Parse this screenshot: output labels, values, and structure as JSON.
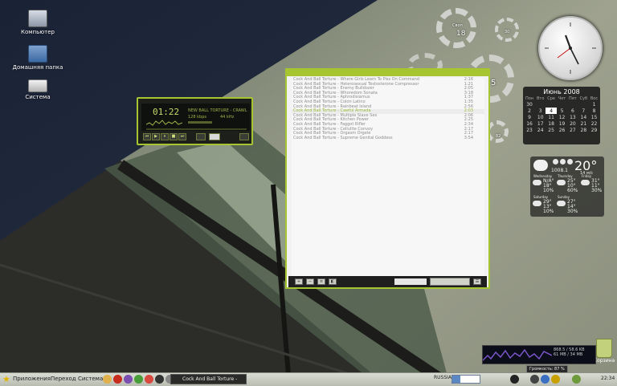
{
  "desktop": {
    "icons": [
      {
        "label": "Компьютер"
      },
      {
        "label": "Домашняя папка"
      },
      {
        "label": "Система"
      }
    ],
    "trash_label": "Корзина"
  },
  "widgets": {
    "ring_labels": {
      "disk_label": "Своп",
      "disk_value": "18",
      "cpu_value": "30",
      "mem_value": "5",
      "net_value": "82"
    },
    "calendar": {
      "month": "Июнь 2008",
      "weekdays": [
        "Пон",
        "Вто",
        "Сре",
        "Чет",
        "Пят",
        "Суб",
        "Вос"
      ],
      "weeks": [
        [
          "30",
          "",
          "",
          "",
          "",
          "",
          "1"
        ],
        [
          "2",
          "3",
          "4",
          "5",
          "6",
          "7",
          "8"
        ],
        [
          "9",
          "10",
          "11",
          "12",
          "13",
          "14",
          "15"
        ],
        [
          "16",
          "17",
          "18",
          "19",
          "20",
          "21",
          "22"
        ],
        [
          "23",
          "24",
          "25",
          "26",
          "27",
          "28",
          "29"
        ]
      ],
      "today": "4"
    },
    "weather": {
      "now_temp": "20°",
      "pressure": "1008.1",
      "wind": "14 м/с",
      "rows": [
        {
          "day": "Wednesday",
          "hi": "N/A°",
          "lo": "18°",
          "pct": "10%"
        },
        {
          "day": "Thursday",
          "hi": "25°",
          "lo": "10°",
          "pct": "60%"
        },
        {
          "day": "Friday",
          "hi": "31°",
          "lo": "11°",
          "pct": "30%"
        },
        {
          "day": "Saturday",
          "hi": "29°",
          "lo": "13°",
          "pct": "10%"
        },
        {
          "day": "Sunday",
          "hi": "27°",
          "lo": "14°",
          "pct": "30%"
        }
      ]
    }
  },
  "player": {
    "time": "01:22",
    "song": "NEW BALL TORTURE - CRAWL ARMED",
    "bitrate": "128 kbps",
    "khz": "44 kHz",
    "buttons": [
      "⏮",
      "▶",
      "⏸",
      "■",
      "⏭"
    ]
  },
  "playlist": {
    "tracks": [
      {
        "title": "Cock And Ball Torture - Where Girls Learn To Piss On Command",
        "dur": "2:16"
      },
      {
        "title": "Cock And Ball Torture - Heterosexual Testosterone Compressor",
        "dur": "1:21"
      },
      {
        "title": "Cock And Ball Torture - Enemy Bulldozer",
        "dur": "2:05"
      },
      {
        "title": "Cock And Ball Torture - Whoredom Sonata",
        "dur": "3:18"
      },
      {
        "title": "Cock And Ball Torture - Aphrodisiamus",
        "dur": "1:37"
      },
      {
        "title": "Cock And Ball Torture - Colon Latino",
        "dur": "1:35"
      },
      {
        "title": "Cock And Ball Torture - Rainbeat Island",
        "dur": "2:56"
      },
      {
        "title": "Cock And Ball Torture - Cawful Armada",
        "dur": "2:03"
      },
      {
        "title": "Cock And Ball Torture - Multiple Slave Sex",
        "dur": "2:06"
      },
      {
        "title": "Cock And Ball Torture - Kitchen Power",
        "dur": "2:25"
      },
      {
        "title": "Cock And Ball Torture - Faggot Rifler",
        "dur": "2:34"
      },
      {
        "title": "Cock And Ball Torture - Cellulite Convoy",
        "dur": "2:17"
      },
      {
        "title": "Cock And Ball Torture - Orgasm Orgele",
        "dur": "2:17"
      },
      {
        "title": "Cock And Ball Torture - Supreme Genital Goddess",
        "dur": "3:54"
      }
    ],
    "selected": 7,
    "buttons": [
      "+",
      "−",
      "≡",
      "◧",
      "☰"
    ]
  },
  "netmon": {
    "line1": "868.5 / 58.6 KB",
    "line2": "61 MB / 34 MB"
  },
  "taskbar": {
    "menu_apps": "Приложения",
    "menu_go": "Переход",
    "menu_system": "Система",
    "task_title": "Cock And Ball Torture -",
    "clock": "22:34",
    "tooltip": "Громкость: 87 %",
    "lang": "RUSSIAN"
  },
  "colors": {
    "accent": "#a7c431",
    "panel": "#cfd2c8"
  }
}
